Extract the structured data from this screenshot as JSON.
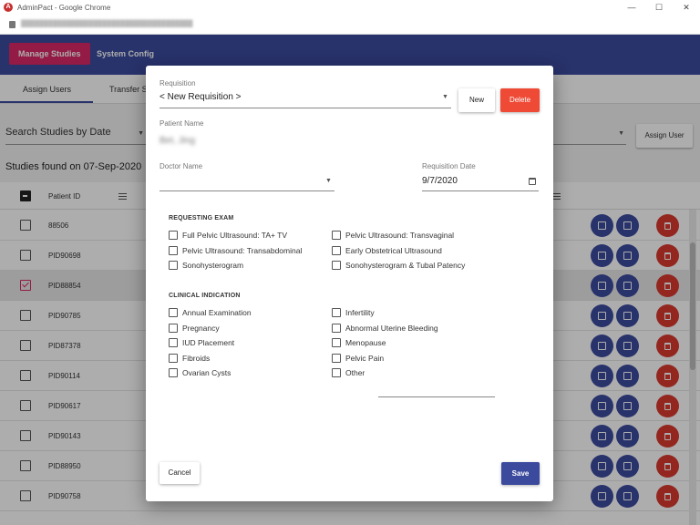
{
  "window": {
    "title": "AdminPact - Google Chrome",
    "app_icon": "A",
    "controls": [
      "—",
      "☐",
      "✕"
    ]
  },
  "header": {
    "nav": [
      {
        "label": "Manage Studies",
        "active": true
      },
      {
        "label": "System Config",
        "active": false
      }
    ]
  },
  "tabs": [
    {
      "label": "Assign Users",
      "active": true
    },
    {
      "label": "Transfer S",
      "active": false
    }
  ],
  "search": {
    "label": "Search Studies by Date",
    "assign_button": "Assign User"
  },
  "results": {
    "summary": "Studies found on 07-Sep-2020",
    "column_patient_id": "Patient ID",
    "rows": [
      {
        "id": "88506",
        "selected": false
      },
      {
        "id": "PID90698",
        "selected": false
      },
      {
        "id": "PID88854",
        "selected": true
      },
      {
        "id": "PID90785",
        "selected": false
      },
      {
        "id": "PID87378",
        "selected": false
      },
      {
        "id": "PID90114",
        "selected": false
      },
      {
        "id": "PID90617",
        "selected": false
      },
      {
        "id": "PID90143",
        "selected": false
      },
      {
        "id": "PID88950",
        "selected": false
      },
      {
        "id": "PID90758",
        "selected": false
      }
    ]
  },
  "dialog": {
    "requisition_label": "Requisition",
    "requisition_value": "< New Requisition >",
    "new_button": "New",
    "delete_button": "Delete",
    "patient_name_label": "Patient Name",
    "patient_name_value": "Bet, Jing",
    "doctor_name_label": "Doctor Name",
    "doctor_name_value": "",
    "requisition_date_label": "Requisition Date",
    "requisition_date_value": "9/7/2020",
    "requesting_exam": {
      "heading": "REQUESTING EXAM",
      "options": [
        "Full Pelvic Ultrasound: TA+ TV",
        "Pelvic Ultrasound: Transvaginal",
        "Pelvic Ultrasound: Transabdominal",
        "Early Obstetrical Ultrasound",
        "Sonohysterogram",
        "Sonohysterogram & Tubal Patency"
      ]
    },
    "clinical_indication": {
      "heading": "CLINICAL INDICATION",
      "options": [
        "Annual Examination",
        "Infertility",
        "Pregnancy",
        "Abnormal Uterine Bleeding",
        "IUD Placement",
        "Menopause",
        "Fibroids",
        "Pelvic Pain",
        "Ovarian Cysts",
        "Other"
      ]
    },
    "other_value": "",
    "cancel_button": "Cancel",
    "save_button": "Save"
  },
  "colors": {
    "primary": "#3c4a9e",
    "accent": "#d92966",
    "danger": "#ef4a36"
  }
}
